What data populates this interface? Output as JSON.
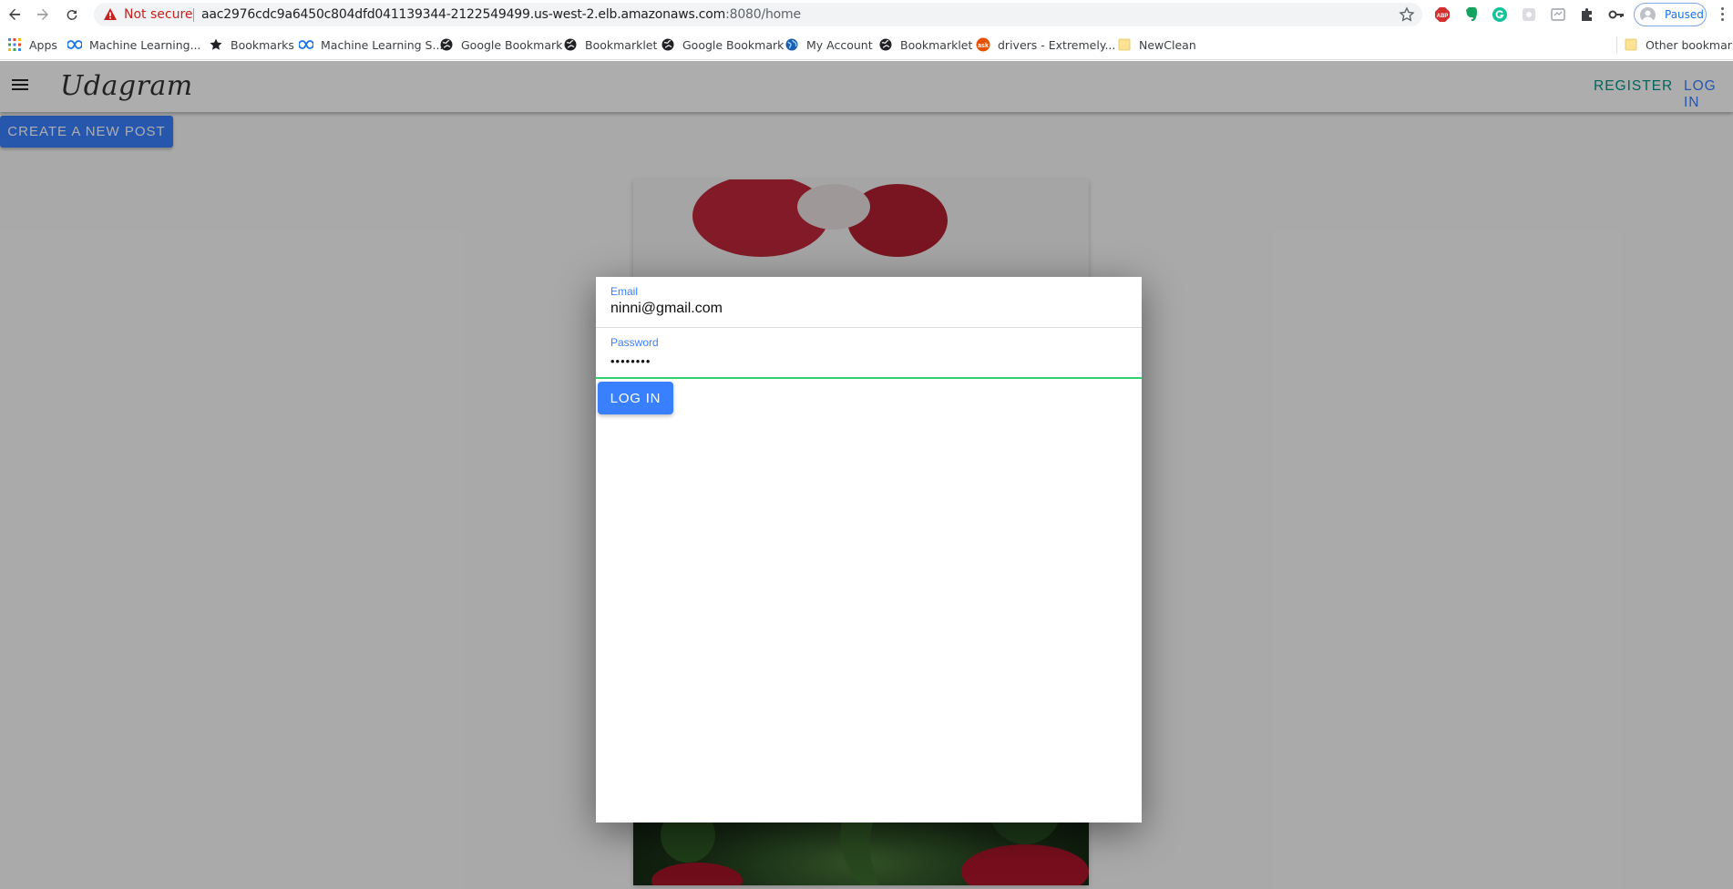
{
  "browser": {
    "security_label": "Not secure",
    "url_host": "aac2976cdc9a6450c804dfd041139344-2122549499.us-west-2.elb.amazonaws.com",
    "url_path": ":8080/home",
    "profile_label": "Paused",
    "bookmarks": [
      {
        "label": "Apps",
        "icon": "apps-grid-icon"
      },
      {
        "label": "Machine Learning...",
        "icon": "infinity-icon"
      },
      {
        "label": "Bookmarks",
        "icon": "star-icon"
      },
      {
        "label": "Machine Learning S...",
        "icon": "infinity-icon"
      },
      {
        "label": "Google Bookmark",
        "icon": "globe-icon"
      },
      {
        "label": "Bookmarklet",
        "icon": "globe-icon"
      },
      {
        "label": "Google Bookmark",
        "icon": "globe-icon"
      },
      {
        "label": "My Account",
        "icon": "world-icon"
      },
      {
        "label": "Bookmarklet",
        "icon": "globe-icon"
      },
      {
        "label": "drivers - Extremely...",
        "icon": "ask-icon"
      },
      {
        "label": "NewClean",
        "icon": "folder-icon"
      }
    ],
    "other_bookmarks": "Other bookmarks",
    "extensions": [
      "abp-icon",
      "evernote-icon",
      "grammarly-icon",
      "extension-icon",
      "screenshot-icon",
      "puzzle-icon",
      "key-icon"
    ]
  },
  "app": {
    "brand": "Udagram",
    "nav": {
      "register": "REGISTER",
      "login": "LOG IN"
    },
    "create_post": "CREATE A NEW POST"
  },
  "login_modal": {
    "email_label": "Email",
    "email_value": "ninni@gmail.com",
    "password_label": "Password",
    "password_value": "••••••••",
    "submit_label": "LOG IN"
  },
  "colors": {
    "primary": "#3880ff",
    "register": "#009688",
    "active_underline": "#2dd36f",
    "not_secure": "#c5221f"
  }
}
